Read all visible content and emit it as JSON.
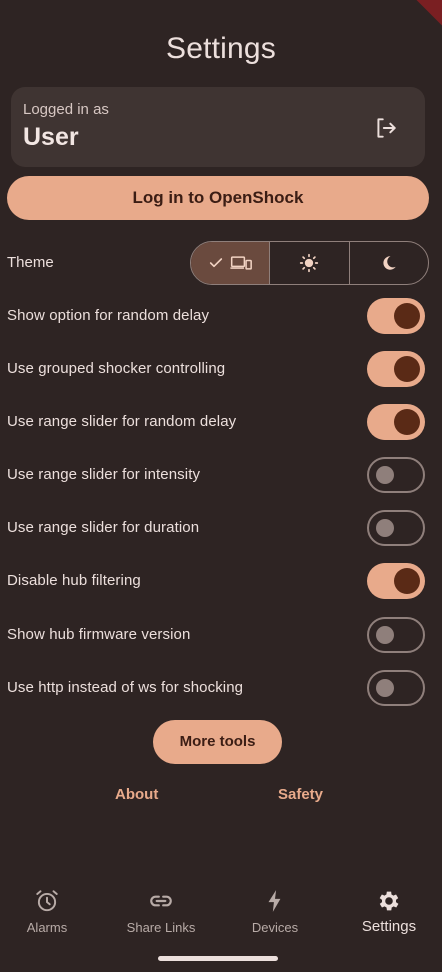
{
  "page": {
    "title": "Settings"
  },
  "account": {
    "caption": "Logged in as",
    "username": "User",
    "logout_icon": "logout-icon"
  },
  "login_button": "Log in to OpenShock",
  "theme": {
    "label": "Theme",
    "options": [
      {
        "icon": "devices-icon",
        "selected": true
      },
      {
        "icon": "sun-icon",
        "selected": false
      },
      {
        "icon": "moon-icon",
        "selected": false
      }
    ]
  },
  "toggles": [
    {
      "label": "Show option for random delay",
      "on": true
    },
    {
      "label": "Use grouped shocker controlling",
      "on": true
    },
    {
      "label": "Use range slider for random delay",
      "on": true
    },
    {
      "label": "Use range slider for intensity",
      "on": false
    },
    {
      "label": "Use range slider for duration",
      "on": false
    },
    {
      "label": "Disable hub filtering",
      "on": true
    },
    {
      "label": "Show hub firmware version",
      "on": false
    },
    {
      "label": "Use http instead of ws for shocking",
      "on": false
    }
  ],
  "more_tools": "More tools",
  "links": {
    "about": "About",
    "safety": "Safety"
  },
  "nav": [
    {
      "label": "Alarms",
      "icon": "alarm-icon",
      "active": false
    },
    {
      "label": "Share Links",
      "icon": "link-icon",
      "active": false
    },
    {
      "label": "Devices",
      "icon": "bolt-icon",
      "active": false
    },
    {
      "label": "Settings",
      "icon": "gear-icon",
      "active": true
    }
  ],
  "colors": {
    "background": "#2e2423",
    "accent": "#e8aa8b",
    "switch_knob_on": "#5a2a16",
    "outline": "#8f7f7b"
  }
}
